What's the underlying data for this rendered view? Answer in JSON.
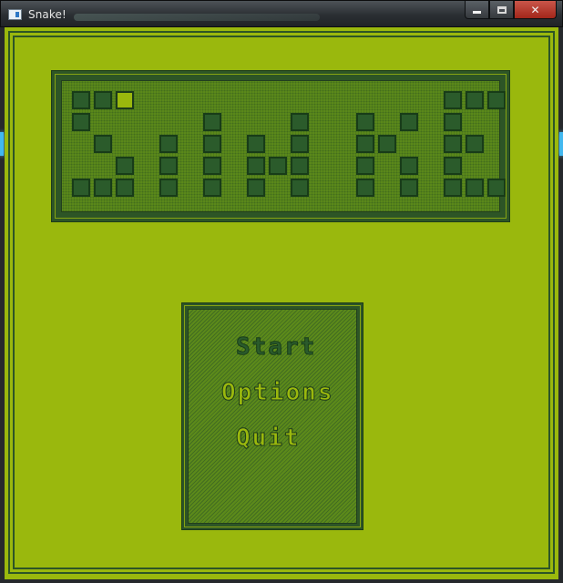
{
  "window": {
    "title": "Snake!",
    "app_icon": "app-window-icon",
    "buttons": {
      "minimize_icon": "minimize-icon",
      "maximize_icon": "maximize-icon",
      "close_symbol": "✕"
    }
  },
  "logo": {
    "text": "SNAKE",
    "tile_color": "#2b5b2b",
    "head_color": "#9ab80d"
  },
  "menu": {
    "items": [
      {
        "label": "Start",
        "selected": true
      },
      {
        "label": "Options",
        "selected": false
      },
      {
        "label": "Quit",
        "selected": false
      }
    ]
  },
  "colors": {
    "background": "#9ab80d",
    "dark_green": "#2d5526",
    "panel_fill": "#5c8a1a"
  }
}
